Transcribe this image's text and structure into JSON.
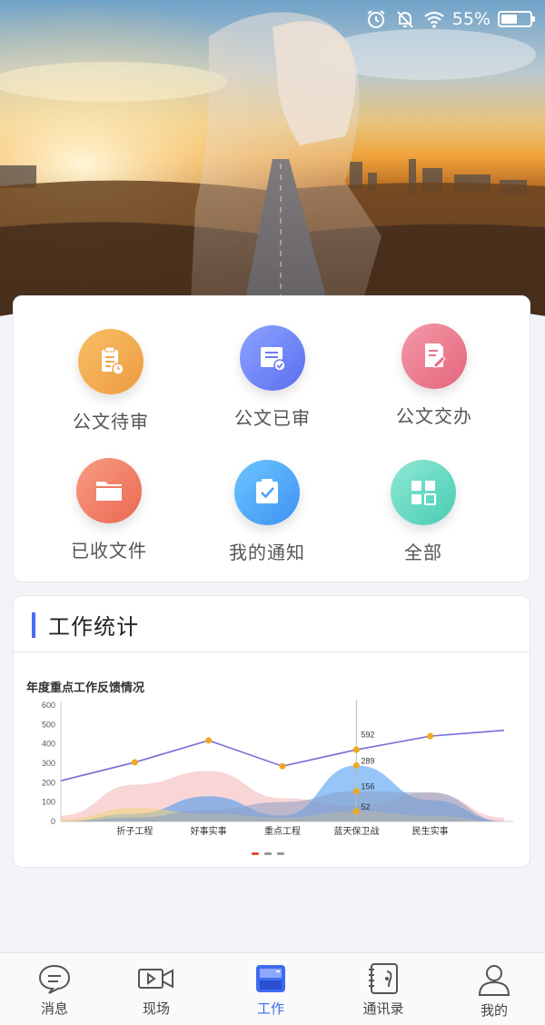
{
  "status": {
    "battery_text": "55%",
    "battery_level": 0.55
  },
  "grid": [
    {
      "label": "公文待审",
      "icon": "clipboard-clock-icon",
      "color_from": "#f8c064",
      "color_to": "#ee9a42"
    },
    {
      "label": "公文已审",
      "icon": "approved-doc-icon",
      "color_from": "#8ea3ff",
      "color_to": "#5a6ff0"
    },
    {
      "label": "公文交办",
      "icon": "edit-doc-icon",
      "color_from": "#f49aa8",
      "color_to": "#e5647c"
    },
    {
      "label": "已收文件",
      "icon": "folder-icon",
      "color_from": "#f79c82",
      "color_to": "#ea6852"
    },
    {
      "label": "我的通知",
      "icon": "notice-check-icon",
      "color_from": "#6cc5ff",
      "color_to": "#3e92f2"
    },
    {
      "label": "全部",
      "icon": "grid-apps-icon",
      "color_from": "#8ee8d4",
      "color_to": "#49cdb3"
    }
  ],
  "stats": {
    "title": "工作统计",
    "accent": "#4a6cf7"
  },
  "chart_data": {
    "type": "line",
    "title": "年度重点工作反馈情况",
    "categories": [
      "折子工程",
      "好事实事",
      "重点工程",
      "蓝天保卫战",
      "民生实事"
    ],
    "ylim": [
      0,
      600
    ],
    "yticks": [
      0,
      100,
      200,
      300,
      400,
      500,
      600
    ],
    "series": [
      {
        "name": "",
        "kind": "line",
        "color": "#7a6bd6",
        "values": [
          210,
          305,
          418,
          285,
          370,
          440,
          470
        ]
      },
      {
        "name": "",
        "kind": "area",
        "color": "#f4b4b4",
        "values": [
          30,
          190,
          260,
          120,
          80,
          150,
          20
        ]
      },
      {
        "name": "",
        "kind": "area",
        "color": "#3f95f0",
        "values": [
          0,
          40,
          130,
          30,
          289,
          110,
          0
        ]
      },
      {
        "name": "",
        "kind": "area",
        "color": "#f1d37a",
        "values": [
          10,
          70,
          40,
          20,
          52,
          30,
          0
        ]
      },
      {
        "name": "",
        "kind": "area",
        "color": "#8a9fc4",
        "values": [
          0,
          20,
          60,
          100,
          156,
          150,
          0
        ]
      }
    ],
    "tooltip": {
      "category": "蓝天保卫战",
      "values": [
        592,
        289,
        156,
        52
      ]
    },
    "page_indicator": {
      "count": 3,
      "active": 0
    }
  },
  "tabbar": [
    {
      "label": "消息",
      "icon": "message-icon",
      "active": false
    },
    {
      "label": "现场",
      "icon": "video-icon",
      "active": false
    },
    {
      "label": "工作",
      "icon": "work-briefcase-icon",
      "active": true
    },
    {
      "label": "通讯录",
      "icon": "contacts-book-icon",
      "active": false
    },
    {
      "label": "我的",
      "icon": "user-profile-icon",
      "active": false
    }
  ]
}
